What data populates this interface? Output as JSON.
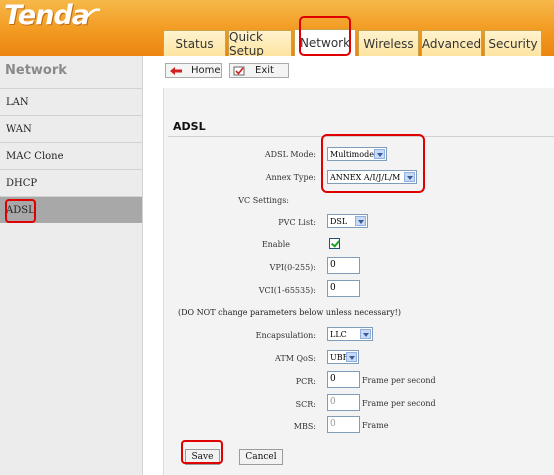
{
  "header": {
    "logo": "Tenda",
    "tabs": [
      {
        "label": "Status"
      },
      {
        "label": "Quick Setup"
      },
      {
        "label": "Network"
      },
      {
        "label": "Wireless"
      },
      {
        "label": "Advanced"
      },
      {
        "label": "Security"
      }
    ],
    "active_tab": "Network"
  },
  "sidebar": {
    "title": "Network",
    "items": [
      {
        "label": "LAN"
      },
      {
        "label": "WAN"
      },
      {
        "label": "MAC Clone"
      },
      {
        "label": "DHCP"
      },
      {
        "label": "ADSL"
      }
    ],
    "active_item": "ADSL"
  },
  "toolbar": {
    "home_label": "Home",
    "exit_label": "Exit"
  },
  "section": {
    "title": "ADSL"
  },
  "form": {
    "adsl_mode": {
      "label": "ADSL Mode:",
      "value": "Multimode"
    },
    "annex_type": {
      "label": "Annex Type:",
      "value": "ANNEX A/I/J/L/M"
    },
    "vc_settings": {
      "label": "VC Settings:"
    },
    "pvc_list": {
      "label": "PVC List:",
      "value": "DSL"
    },
    "enable": {
      "label": "Enable",
      "checked": true
    },
    "vpi": {
      "label": "VPI(0-255):",
      "value": "0"
    },
    "vci": {
      "label": "VCI(1-65535):",
      "value": "0"
    },
    "note": "(DO NOT change parameters below unless necessary!)",
    "encapsulation": {
      "label": "Encapsulation:",
      "value": "LLC"
    },
    "atm_qos": {
      "label": "ATM QoS:",
      "value": "UBR"
    },
    "pcr": {
      "label": "PCR:",
      "value": "0",
      "unit": "Frame per second"
    },
    "scr": {
      "label": "SCR:",
      "value": "0",
      "unit": "Frame per second"
    },
    "mbs": {
      "label": "MBS:",
      "value": "0",
      "unit": "Frame"
    }
  },
  "actions": {
    "save_label": "Save",
    "cancel_label": "Cancel"
  },
  "colors": {
    "header_orange": "#f29a21",
    "highlight_red": "#e00000",
    "sidebar_bg": "#ececec",
    "sidebar_active": "#a8a8a8"
  }
}
